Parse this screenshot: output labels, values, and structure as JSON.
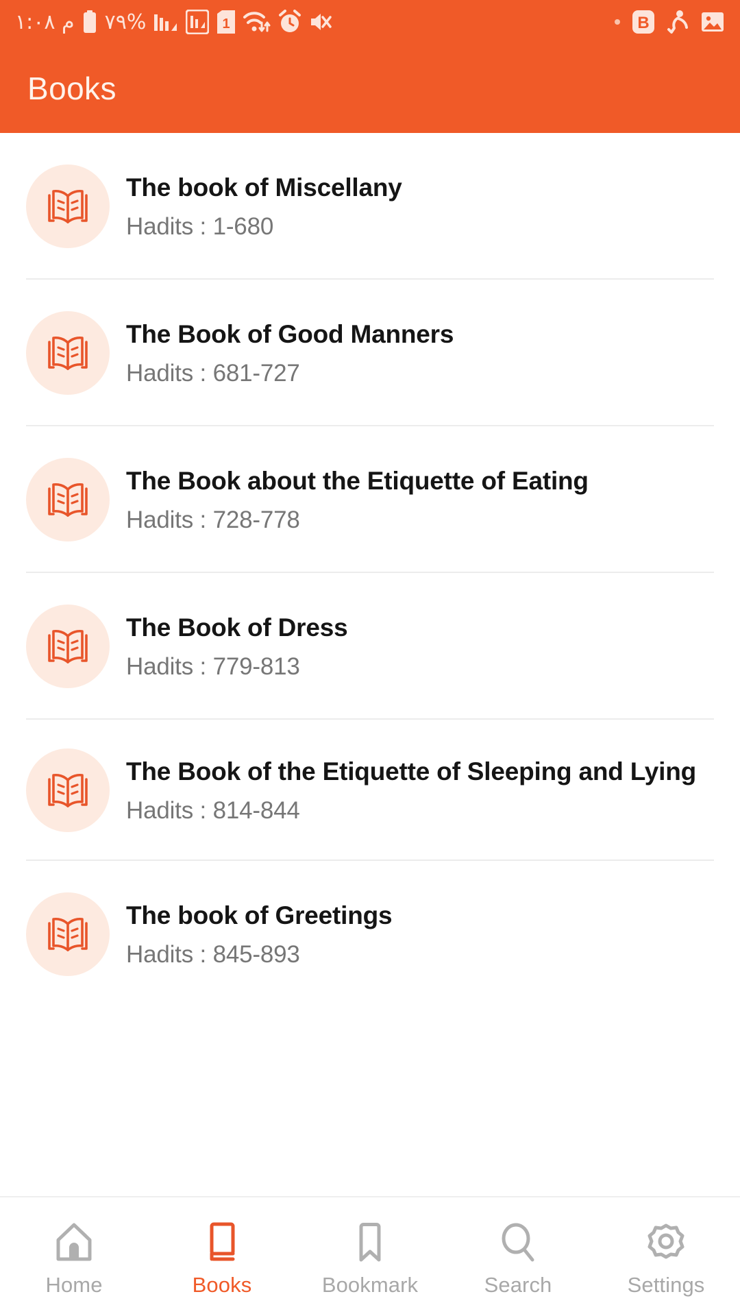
{
  "theme": {
    "accent": "#F05A28",
    "accent_light": "#FDEAE0",
    "header_text": "#FFF3EC",
    "title_text": "#151515",
    "sub_text": "#767676",
    "nav_inactive": "#A8A8A8"
  },
  "statusbar": {
    "time": "م ١:٠٨",
    "battery_percent": "%٧٩",
    "sim_label": "1",
    "icons_left": [
      "battery-icon",
      "signal-bars-icon",
      "signal-bars-boxed-icon",
      "sim-card-icon",
      "wifi-data-icon",
      "alarm-clock-icon",
      "mute-vibrate-icon"
    ],
    "icons_right": [
      "notification-dot-icon",
      "b-app-badge-icon",
      "person-activity-icon",
      "image-gallery-icon"
    ],
    "b_badge_letter": "B"
  },
  "header": {
    "title": "Books"
  },
  "books": [
    {
      "title": "The book of Miscellany",
      "hadits": "Hadits : 1-680",
      "icon": "open-book-icon"
    },
    {
      "title": "The Book of Good Manners",
      "hadits": "Hadits : 681-727",
      "icon": "open-book-icon"
    },
    {
      "title": "The Book about the Etiquette of Eating",
      "hadits": "Hadits : 728-778",
      "icon": "open-book-icon"
    },
    {
      "title": "The Book of Dress",
      "hadits": "Hadits : 779-813",
      "icon": "open-book-icon"
    },
    {
      "title": "The Book of the Etiquette of Sleeping and Lying",
      "hadits": "Hadits : 814-844",
      "icon": "open-book-icon"
    },
    {
      "title": "The book of Greetings",
      "hadits": "Hadits : 845-893",
      "icon": "open-book-icon"
    }
  ],
  "bottom_nav": {
    "active_index": 1,
    "items": [
      {
        "label": "Home",
        "icon": "home-icon"
      },
      {
        "label": "Books",
        "icon": "book-icon"
      },
      {
        "label": "Bookmark",
        "icon": "bookmark-icon"
      },
      {
        "label": "Search",
        "icon": "search-icon"
      },
      {
        "label": "Settings",
        "icon": "gear-icon"
      }
    ]
  }
}
